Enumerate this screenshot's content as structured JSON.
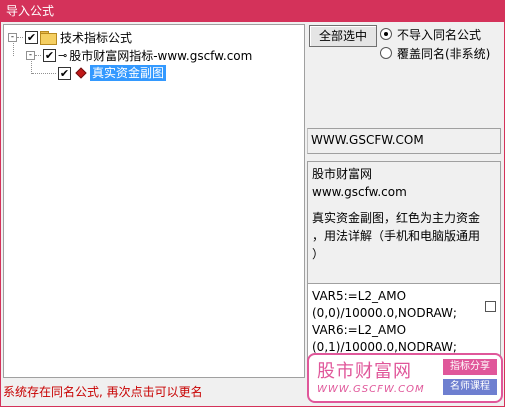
{
  "window": {
    "title": "导入公式",
    "accent": "#d4325a"
  },
  "tree": {
    "root": {
      "label": "技术指标公式",
      "expander": "-",
      "checked": "✔"
    },
    "child": {
      "label": "股市财富网指标-www.gscfw.com",
      "expander": "-",
      "checked": "✔"
    },
    "leaf": {
      "label": "真实资金副图",
      "checked": "✔"
    }
  },
  "buttons": {
    "select_all": "全部选中"
  },
  "options": {
    "no_import_same": "不导入同名公式",
    "overwrite_same": "覆盖同名(非系统)"
  },
  "info": {
    "url": "WWW.GSCFW.COM",
    "desc_line1": "股市财富网",
    "desc_line2": "www.gscfw.com",
    "desc_line3": "真实资金副图，红色为主力资金",
    "desc_line4": "，用法详解（手机和电脑版通用",
    "desc_line5": "）"
  },
  "code": {
    "line1": "VAR5:=L2_AMO",
    "line2": "(0,0)/10000.0,NODRAW;",
    "line3": "VAR6:=L2_AMO",
    "line4": "(0,1)/10000.0,NODRAW;"
  },
  "status": "系统存在同名公式, 再次点击可以更名",
  "watermark": {
    "title": "股市财富网",
    "url": "WWW.GSCFW.COM",
    "tag1": "指标分享",
    "tag2": "名师课程"
  }
}
